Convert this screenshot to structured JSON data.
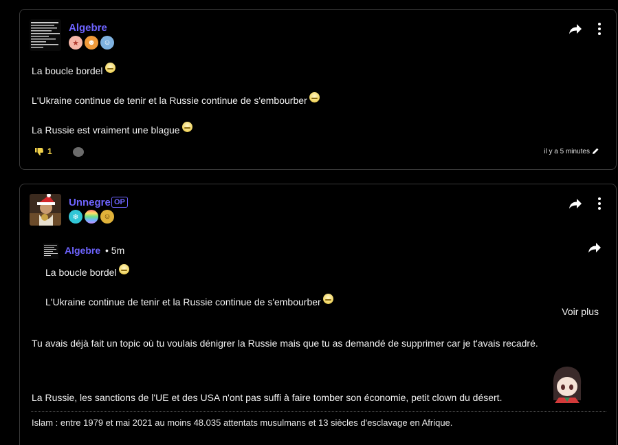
{
  "post1": {
    "author": "Algebre",
    "lines": [
      "La boucle bordel",
      "L'Ukraine continue de tenir et la Russie continue de s'embourber",
      "La Russie est vraiment une blague"
    ],
    "vote_count": "1",
    "timestamp": "il y a 5 minutes"
  },
  "post2": {
    "author": "Unnegre",
    "op_badge": "OP",
    "quote": {
      "author": "Algebre",
      "time": "• 5m",
      "lines": [
        "La boucle bordel",
        "L'Ukraine continue de tenir et la Russie continue de s'embourber"
      ],
      "more_label": "Voir plus"
    },
    "body": [
      "Tu avais déjà fait un topic où tu voulais dénigrer la Russie mais que tu as demandé de supprimer car je t'avais recadré.",
      "La Russie, les sanctions de l'UE et des USA n'ont pas suffi à faire tomber son économie, petit clown du désert."
    ],
    "signature": "Islam : entre 1979 et mai 2021 au moins 48.035 attentats musulmans et 13 siècles d'esclavage en Afrique."
  },
  "icons": {
    "share": "share-arrow-icon",
    "more": "kebab-menu-icon",
    "downvote": "thumbs-down-icon",
    "edit": "pencil-icon"
  },
  "colors": {
    "author": "#6e64ff",
    "vote": "#f2d24b",
    "border": "#3a3a3a"
  }
}
